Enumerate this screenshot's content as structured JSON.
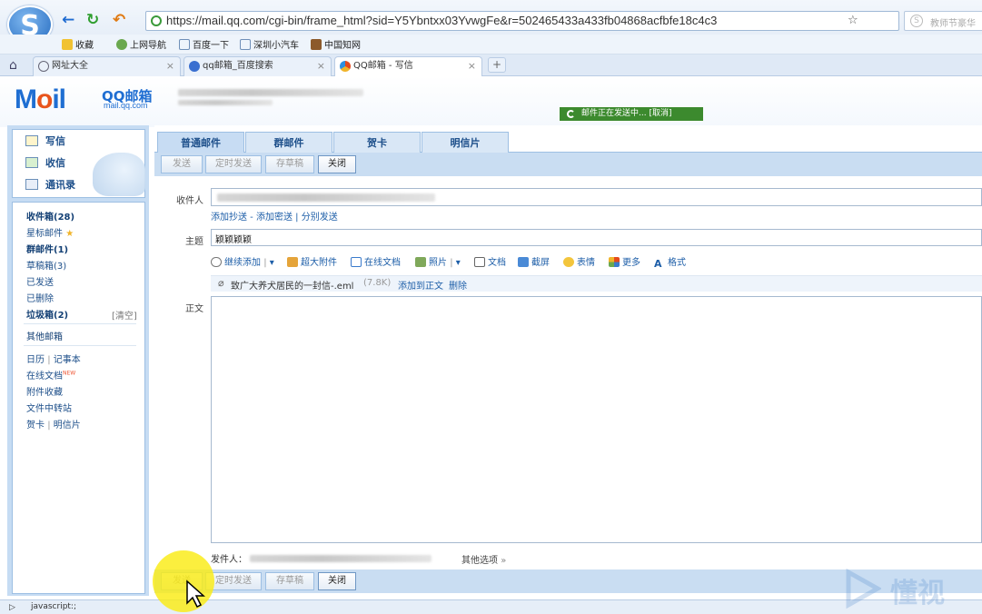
{
  "browser": {
    "logo_glyph": "S",
    "back_glyph": "←",
    "refresh_glyph": "↻",
    "undo_glyph": "↶",
    "url": "https://mail.qq.com/cgi-bin/frame_html?sid=Y5Ybntxx03YvwgFe&r=502465433a433fb04868acfbfe18c4c3",
    "search_placeholder": "教师节豪华",
    "bookmarks": [
      "收藏",
      "上网导航",
      "百度一下",
      "深圳小汽车",
      "中国知网"
    ],
    "tabs": [
      {
        "label": "网址大全"
      },
      {
        "label": "qq邮箱_百度搜索"
      },
      {
        "label": "QQ邮箱 - 写信"
      }
    ],
    "status_text": "javascript:;"
  },
  "mail": {
    "brand_m": "M",
    "brand_o": "o",
    "brand_il": "il",
    "brand_name": "QQ邮箱",
    "brand_domain": "mail.qq.com",
    "sending_notice": "邮件正在发送中... [取消]",
    "sidebar_tools": [
      "写信",
      "收信",
      "通讯录"
    ],
    "folders": [
      "收件箱(28)",
      "星标邮件",
      "群邮件(1)",
      "草稿箱(3)",
      "已发送",
      "已删除",
      "垃圾箱(2)"
    ],
    "clear_label": "[清空]",
    "other_mailbox": "其他邮箱",
    "extras": [
      "日历",
      "记事本",
      "在线文档",
      "附件收藏",
      "文件中转站",
      "贺卡",
      "明信片"
    ],
    "new_badge": "NEW",
    "compose_tabs": [
      "普通邮件",
      "群邮件",
      "贺卡",
      "明信片"
    ],
    "toolbar": [
      "发送",
      "定时发送",
      "存草稿",
      "关闭"
    ],
    "recipient_label": "收件人",
    "recipient_links": "添加抄送 - 添加密送 | 分别发送",
    "subject_label": "主题",
    "subject_value": "颖颖颖颖",
    "editor_tools": [
      "继续添加",
      "超大附件",
      "在线文档",
      "照片",
      "文档",
      "截屏",
      "表情",
      "更多",
      "格式"
    ],
    "attachment_name": "致广大养犬居民的一封信-.eml",
    "attachment_size": "(7.8K)",
    "attachment_actions": [
      "添加到正文",
      "删除"
    ],
    "body_label": "正文",
    "sender_label": "发件人：",
    "other_options": "其他选项",
    "watermark": "懂视"
  }
}
